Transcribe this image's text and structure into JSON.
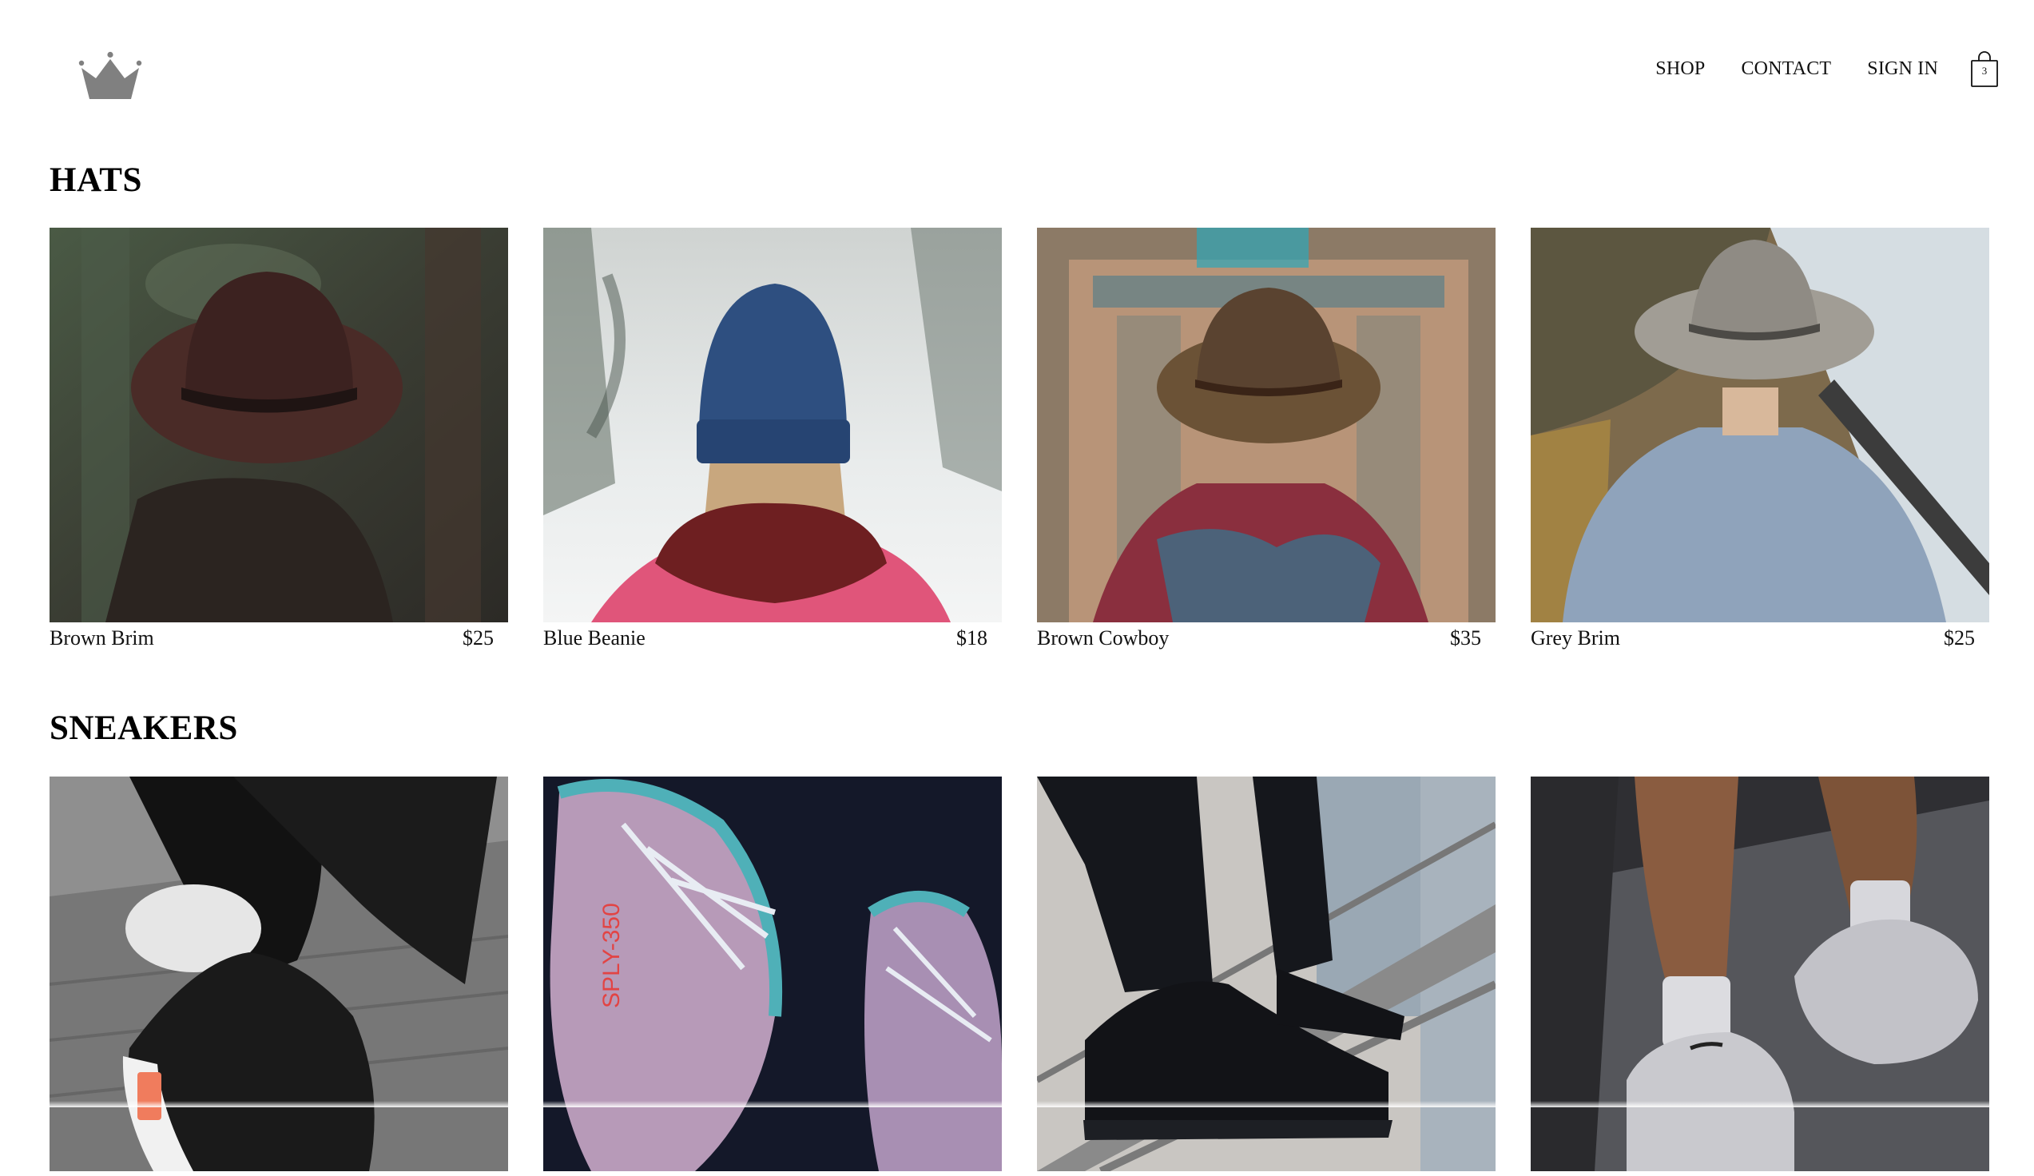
{
  "nav": {
    "logo_icon": "crown-icon",
    "links": [
      "SHOP",
      "CONTACT",
      "SIGN IN"
    ],
    "cart_icon": "shopping-bag-icon",
    "cart_count": "3"
  },
  "sections": [
    {
      "title": "HATS",
      "items": [
        {
          "name": "Brown Brim",
          "price": "$25"
        },
        {
          "name": "Blue Beanie",
          "price": "$18"
        },
        {
          "name": "Brown Cowboy",
          "price": "$35"
        },
        {
          "name": "Grey Brim",
          "price": "$25"
        }
      ]
    },
    {
      "title": "SNEAKERS",
      "items": [
        {
          "name": "",
          "price": ""
        },
        {
          "name": "",
          "price": ""
        },
        {
          "name": "",
          "price": ""
        },
        {
          "name": "",
          "price": ""
        }
      ]
    }
  ],
  "colors": {
    "text": "#111111",
    "logo": "#808080",
    "background": "#ffffff"
  }
}
